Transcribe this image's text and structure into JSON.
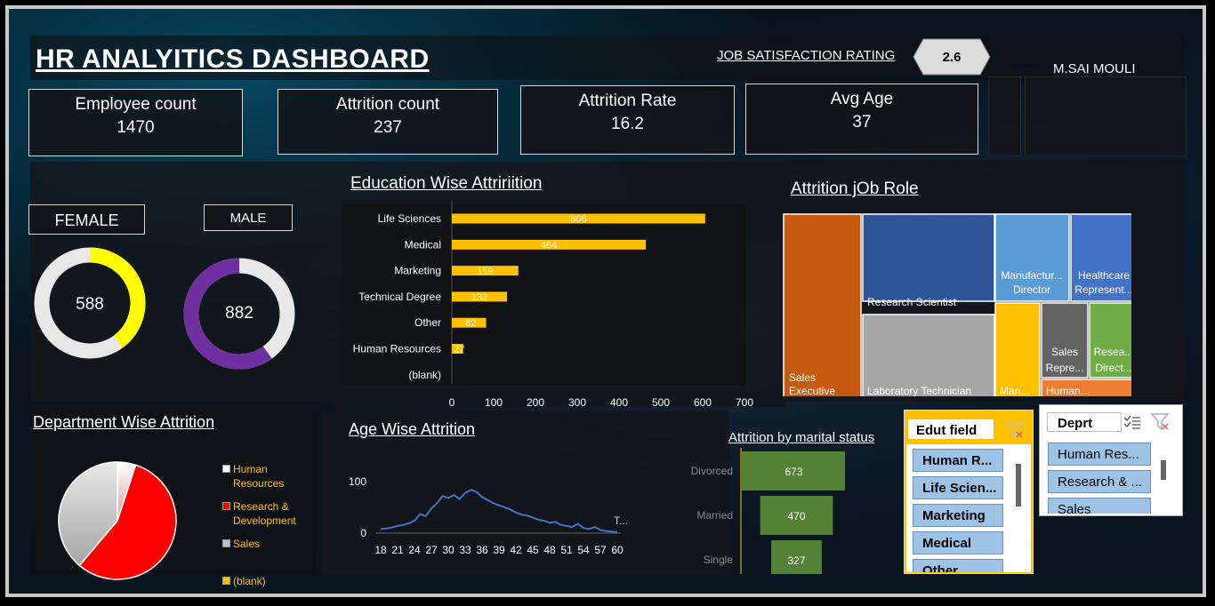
{
  "header": {
    "title": "HR ANALYITICS DASHBOARD",
    "job_sat_label": "JOB SATISFACTION RATING",
    "job_sat_value": "2.6",
    "author": "M.SAI MOULI"
  },
  "kpis": [
    {
      "label": "Employee count",
      "value": "1470"
    },
    {
      "label": "Attrition count",
      "value": "237"
    },
    {
      "label": "Attrition Rate",
      "value": "16.2"
    },
    {
      "label": "Avg Age",
      "value": "37"
    }
  ],
  "gender": {
    "female_label": "FEMALE",
    "male_label": "MALE",
    "female_value": "588",
    "male_value": "882"
  },
  "sections": {
    "education": "Education Wise Attririition",
    "jobrole": "Attrition jOb Role",
    "department": "Department Wise Attrition",
    "age": "Age Wise Attrition",
    "marital": "Attrition by marital status"
  },
  "colors": {
    "gold": "#ffc000",
    "female_ring": "#ffff00",
    "male_ring": "#7030a0",
    "marital_bar": "#548235",
    "line": "#4472c4"
  },
  "chart_data": [
    {
      "type": "donut",
      "name": "female",
      "values": [
        0.4
      ],
      "label": "588"
    },
    {
      "type": "donut",
      "name": "male",
      "values": [
        0.6
      ],
      "label": "882"
    },
    {
      "type": "bar",
      "orientation": "horizontal",
      "title": "Education Wise Attririition",
      "categories": [
        "Life Sciences",
        "Medical",
        "Marketing",
        "Technical Degree",
        "Other",
        "Human Resources",
        "(blank)"
      ],
      "values": [
        606,
        464,
        159,
        132,
        82,
        27,
        0
      ],
      "data_labels": [
        "606",
        "464",
        "159",
        "132",
        "82",
        "27",
        ""
      ],
      "xlim": [
        0,
        700
      ],
      "xticks": [
        "0",
        "100",
        "200",
        "300",
        "400",
        "500",
        "600",
        "700"
      ]
    },
    {
      "type": "treemap",
      "title": "Attrition jOb Role",
      "items": [
        {
          "label": "Sales Executive",
          "value": 57,
          "color": "#c55a11"
        },
        {
          "label": "Research Scientist",
          "value": 47,
          "color": "#2f5597"
        },
        {
          "label": "Laboratory Technician",
          "value": 62,
          "color": "#a5a5a5"
        },
        {
          "label": "Manufactur... Director",
          "value": 10,
          "color": "#5b9bd5"
        },
        {
          "label": "Healthcare Represent...",
          "value": 9,
          "color": "#4472c4"
        },
        {
          "label": "Man...",
          "value": 5,
          "color": "#ffc000"
        },
        {
          "label": "Sales Repre...",
          "value": 33,
          "color": "#636363"
        },
        {
          "label": "Resea... Direct...",
          "value": 2,
          "color": "#70ad47"
        },
        {
          "label": "Human...",
          "value": 12,
          "color": "#ed7d31"
        }
      ]
    },
    {
      "type": "pie",
      "title": "Department Wise Attrition",
      "categories": [
        "Human Resources",
        "Research & Development",
        "Sales",
        "(blank)"
      ],
      "values": [
        12,
        133,
        92,
        0
      ],
      "colors": [
        "#ffffff",
        "#ff0000",
        "#bfbfbf",
        "#ffc000"
      ]
    },
    {
      "type": "line",
      "title": "Age Wise Attrition",
      "xticks": [
        "18",
        "21",
        "24",
        "27",
        "30",
        "33",
        "36",
        "39",
        "42",
        "45",
        "48",
        "51",
        "54",
        "57",
        "60"
      ],
      "x_range": [
        18,
        60
      ],
      "y": [
        8,
        9,
        11,
        14,
        16,
        19,
        24,
        37,
        33,
        48,
        58,
        72,
        68,
        74,
        66,
        78,
        84,
        80,
        70,
        64,
        58,
        54,
        50,
        46,
        40,
        36,
        34,
        30,
        26,
        24,
        20,
        22,
        16,
        14,
        12,
        18,
        10,
        8,
        12,
        6,
        4,
        3,
        2
      ],
      "ylim": [
        0,
        100
      ],
      "yticks": [
        "0",
        "100"
      ],
      "end_label": "T..."
    },
    {
      "type": "bar",
      "orientation": "horizontal-funnel",
      "title": "Attrition by marital status",
      "categories": [
        "Divorced",
        "Married",
        "Single"
      ],
      "values": [
        673,
        470,
        327
      ]
    }
  ],
  "slicers": {
    "edu": {
      "header": "Edut field",
      "items": [
        "Human R...",
        "Life Scien...",
        "Marketing",
        "Medical",
        "Other"
      ]
    },
    "dept": {
      "header": "Deprt",
      "items": [
        "Human Res...",
        "Research & ...",
        "Sales"
      ]
    }
  }
}
